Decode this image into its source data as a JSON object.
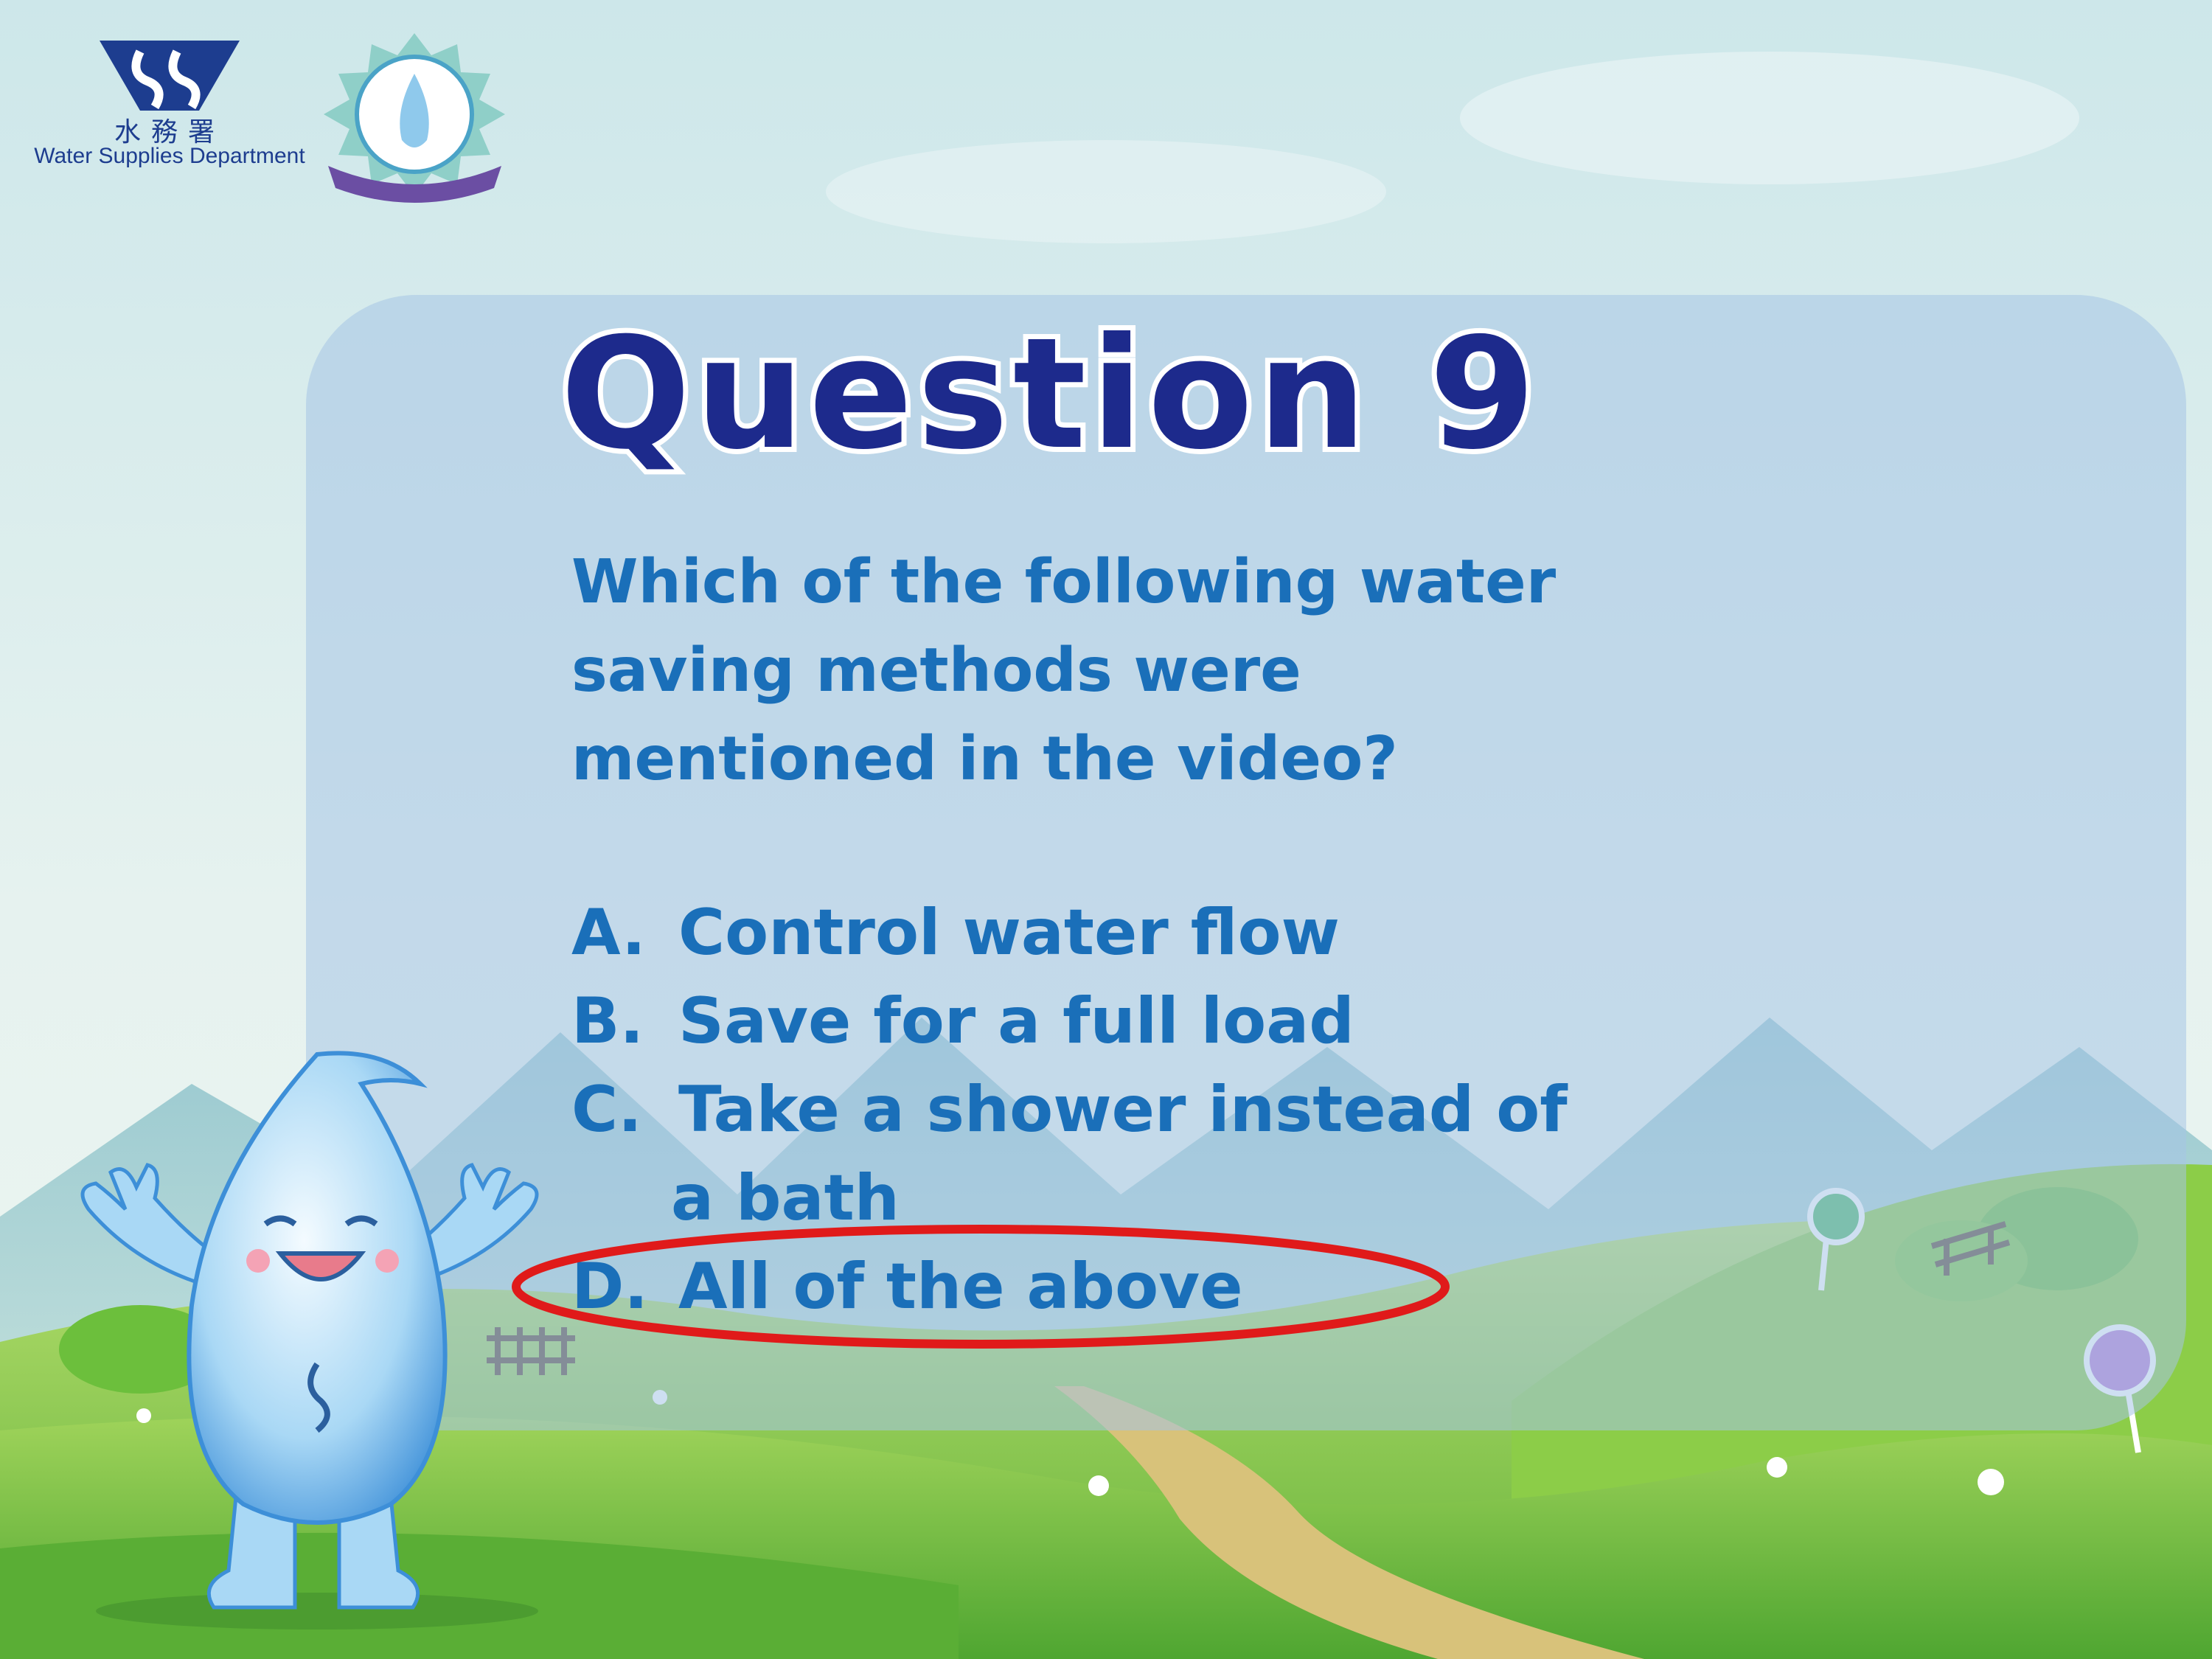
{
  "logo": {
    "chinese_name": "水務署",
    "english_name": "Water Supplies Department",
    "badge_icon": "water-drop-mascot-badge"
  },
  "question": {
    "title": "Question 9",
    "text_lines": [
      "Which of the following water",
      "saving methods were",
      "mentioned in the video?"
    ]
  },
  "options": [
    {
      "letter": "A.",
      "text": "Control water flow"
    },
    {
      "letter": "B.",
      "text": "Save for a full load"
    },
    {
      "letter": "C.",
      "text": "Take a shower instead of",
      "text_cont": "a bath"
    },
    {
      "letter": "D.",
      "text": "All of the above"
    }
  ],
  "answer": {
    "selected_letter": "D.",
    "marker": "red-ellipse-icon"
  },
  "colors": {
    "title_fill": "#1d2a8c",
    "body_text": "#1a6fb9",
    "highlight": "#e01a1a",
    "panel": "#a5c4e6",
    "sky_top": "#cfe6ec",
    "grass": "#7cc242"
  }
}
